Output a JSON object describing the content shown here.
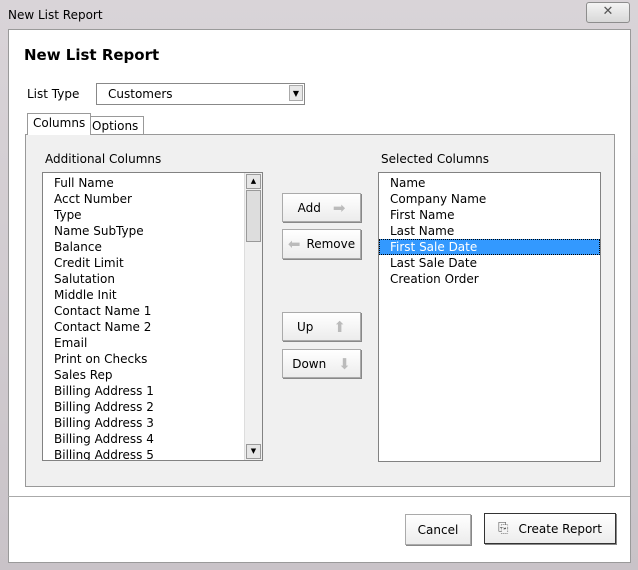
{
  "window": {
    "title": "New List Report",
    "close": "✕"
  },
  "heading": "New List Report",
  "list_type": {
    "label": "List Type",
    "value": "Customers"
  },
  "tabs": [
    {
      "label": "Columns"
    },
    {
      "label": "Options"
    }
  ],
  "additional": {
    "label": "Additional Columns",
    "items": [
      "Full Name",
      "Acct Number",
      "Type",
      "Name SubType",
      "Balance",
      "Credit Limit",
      "Salutation",
      "Middle Init",
      "Contact Name 1",
      "Contact Name 2",
      "Email",
      "Print on Checks",
      "Sales Rep",
      "Billing Address 1",
      "Billing Address 2",
      "Billing Address 3",
      "Billing Address 4",
      "Billing Address 5"
    ]
  },
  "selected": {
    "label": "Selected Columns",
    "items": [
      "Name",
      "Company Name",
      "First Name",
      "Last Name",
      "First Sale Date",
      "Last Sale Date",
      "Creation Order"
    ],
    "selected_index": 4
  },
  "buttons": {
    "add": "Add",
    "remove": "Remove",
    "up": "Up",
    "down": "Down",
    "cancel": "Cancel",
    "create": "Create Report"
  }
}
